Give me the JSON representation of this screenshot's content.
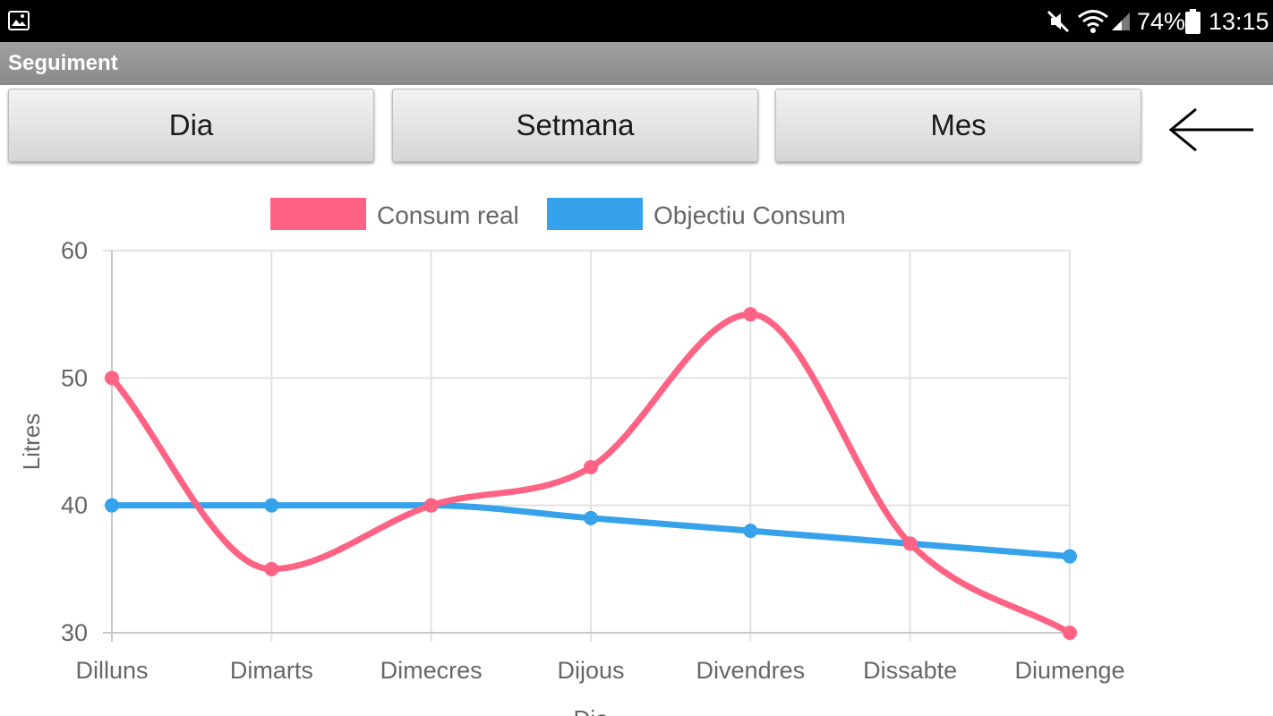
{
  "status_bar": {
    "battery_percent": "74%",
    "time": "13:15",
    "icons": [
      "image-icon",
      "mute-icon",
      "wifi-icon",
      "signal-icon",
      "battery-icon"
    ]
  },
  "app": {
    "title": "Seguiment"
  },
  "toolbar": {
    "dia_label": "Dia",
    "setmana_label": "Setmana",
    "mes_label": "Mes",
    "back_icon": "arrow-left-icon"
  },
  "chart_data": {
    "type": "line",
    "categories": [
      "Dilluns",
      "Dimarts",
      "Dimecres",
      "Dijous",
      "Divendres",
      "Dissabte",
      "Diumenge"
    ],
    "series": [
      {
        "name": "Consum real",
        "color": "#ff6384",
        "values": [
          50,
          35,
          40,
          43,
          55,
          37,
          30
        ]
      },
      {
        "name": "Objectiu Consum",
        "color": "#36a2eb",
        "values": [
          40,
          40,
          40,
          39,
          38,
          37,
          36
        ]
      }
    ],
    "ylabel": "Litres",
    "xlabel": "Dia",
    "ylim": [
      30,
      60
    ],
    "yticks": [
      30,
      40,
      50,
      60
    ],
    "grid": true,
    "legend_position": "top"
  }
}
